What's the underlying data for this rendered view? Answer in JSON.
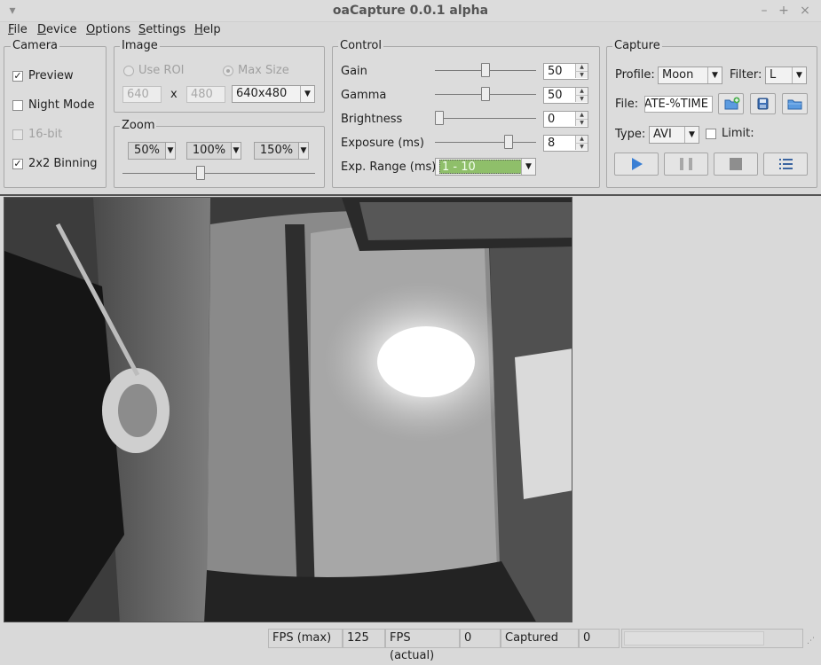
{
  "window": {
    "title": "oaCapture 0.0.1 alpha",
    "controls": {
      "collapse": "▾",
      "minimize": "–",
      "maximize": "+",
      "close": "×"
    }
  },
  "menu": [
    "File",
    "Device",
    "Options",
    "Settings",
    "Help"
  ],
  "camera": {
    "title": "Camera",
    "preview": {
      "label": "Preview",
      "checked": true
    },
    "night_mode": {
      "label": "Night Mode",
      "checked": false
    },
    "bit16": {
      "label": "16-bit",
      "checked": false,
      "enabled": false
    },
    "binning": {
      "label": "2x2 Binning",
      "checked": true
    }
  },
  "image": {
    "title": "Image",
    "use_roi": "Use ROI",
    "max_size": "Max Size",
    "width": "640",
    "x_sep": "x",
    "height": "480",
    "resolution": "640x480"
  },
  "zoom": {
    "title": "Zoom",
    "options": [
      "50%",
      "100%",
      "150%"
    ],
    "slider_level": 0.4
  },
  "control": {
    "title": "Control",
    "rows": [
      {
        "label": "Gain",
        "value": "50",
        "slider_level": 0.5
      },
      {
        "label": "Gamma",
        "value": "50",
        "slider_level": 0.5
      },
      {
        "label": "Brightness",
        "value": "0",
        "slider_level": 0.0
      },
      {
        "label": "Exposure (ms)",
        "value": "8",
        "slider_level": 0.75
      }
    ],
    "exp_range_label": "Exp. Range (ms)",
    "exp_range_value": "1 - 10",
    "exp_range_color": "#8fbf6a"
  },
  "capture": {
    "title": "Capture",
    "profile_label": "Profile:",
    "profile_value": "Moon",
    "filter_label": "Filter:",
    "filter_value": "L",
    "file_label": "File:",
    "file_value": "DATE-%TIME",
    "type_label": "Type:",
    "type_value": "AVI",
    "limit_label": "Limit:",
    "accent_color": "#3a7fd4"
  },
  "status": {
    "fps_max_label": "FPS (max)",
    "fps_max_value": "125",
    "fps_actual_label": "FPS (actual)",
    "fps_actual_value": "0",
    "captured_label": "Captured",
    "captured_value": "0"
  }
}
